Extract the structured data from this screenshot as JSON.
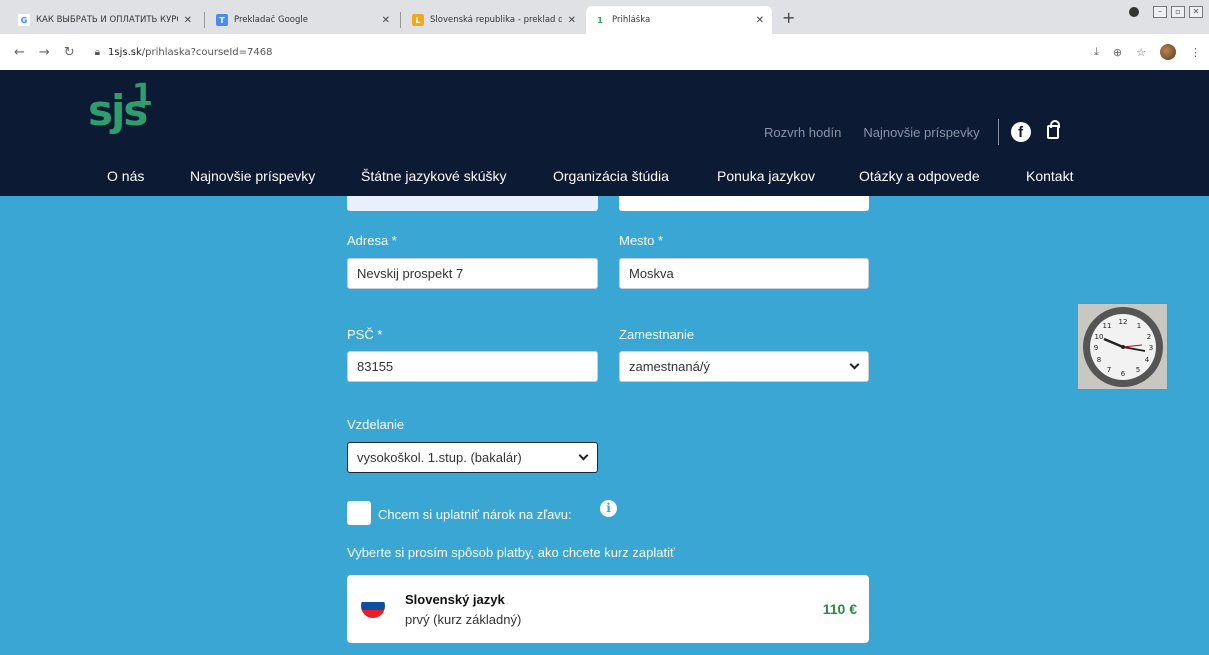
{
  "browser": {
    "tabs": [
      {
        "title": "КАК ВЫБРАТЬ И ОПЛАТИТЬ КУРС",
        "icon": "google-icon",
        "color": "#4285f4",
        "glyph": "G"
      },
      {
        "title": "Prekladač Google",
        "icon": "translate-icon",
        "color": "#4a8af4",
        "glyph": "T"
      },
      {
        "title": "Slovenská republika - preklad do ru",
        "icon": "dictionary-icon",
        "color": "#f0a81c",
        "glyph": "L"
      },
      {
        "title": "Prihláška",
        "icon": "site-icon",
        "color": "#2f9e6f",
        "glyph": "1"
      }
    ],
    "url_domain": "1sjs.sk",
    "url_path": "/prihlaska?courseId=7468"
  },
  "site": {
    "logo_text": "sjs",
    "logo_number": "1",
    "brand_color": "#2f9e6f",
    "top_links": [
      "Rozvrh hodín",
      "Najnovšie príspevky"
    ],
    "nav": [
      "O nás",
      "Najnovšie príspevky",
      "Štátne jazykové skúšky",
      "Organizácia štúdia",
      "Ponuka jazykov",
      "Otázky a odpovede",
      "Kontakt"
    ]
  },
  "form": {
    "adresa_label": "Adresa *",
    "adresa_value": "Nevskij prospekt 7",
    "mesto_label": "Mesto *",
    "mesto_value": "Moskva",
    "psc_label": "PSČ *",
    "psc_value": "83155",
    "zamestnanie_label": "Zamestnanie",
    "zamestnanie_value": "zamestnaná/ý",
    "vzdelanie_label": "Vzdelanie",
    "vzdelanie_value": "vysokoškol. 1.stup. (bakalár)",
    "zlava_label": "Chcem si uplatniť nárok na zľavu:",
    "platba_text": "Vyberte si prosím spôsob platby, ako chcete kurz zaplatiť"
  },
  "course": {
    "name": "Slovenský jazyk",
    "level": "prvý (kurz základný)",
    "price": "110 €"
  }
}
